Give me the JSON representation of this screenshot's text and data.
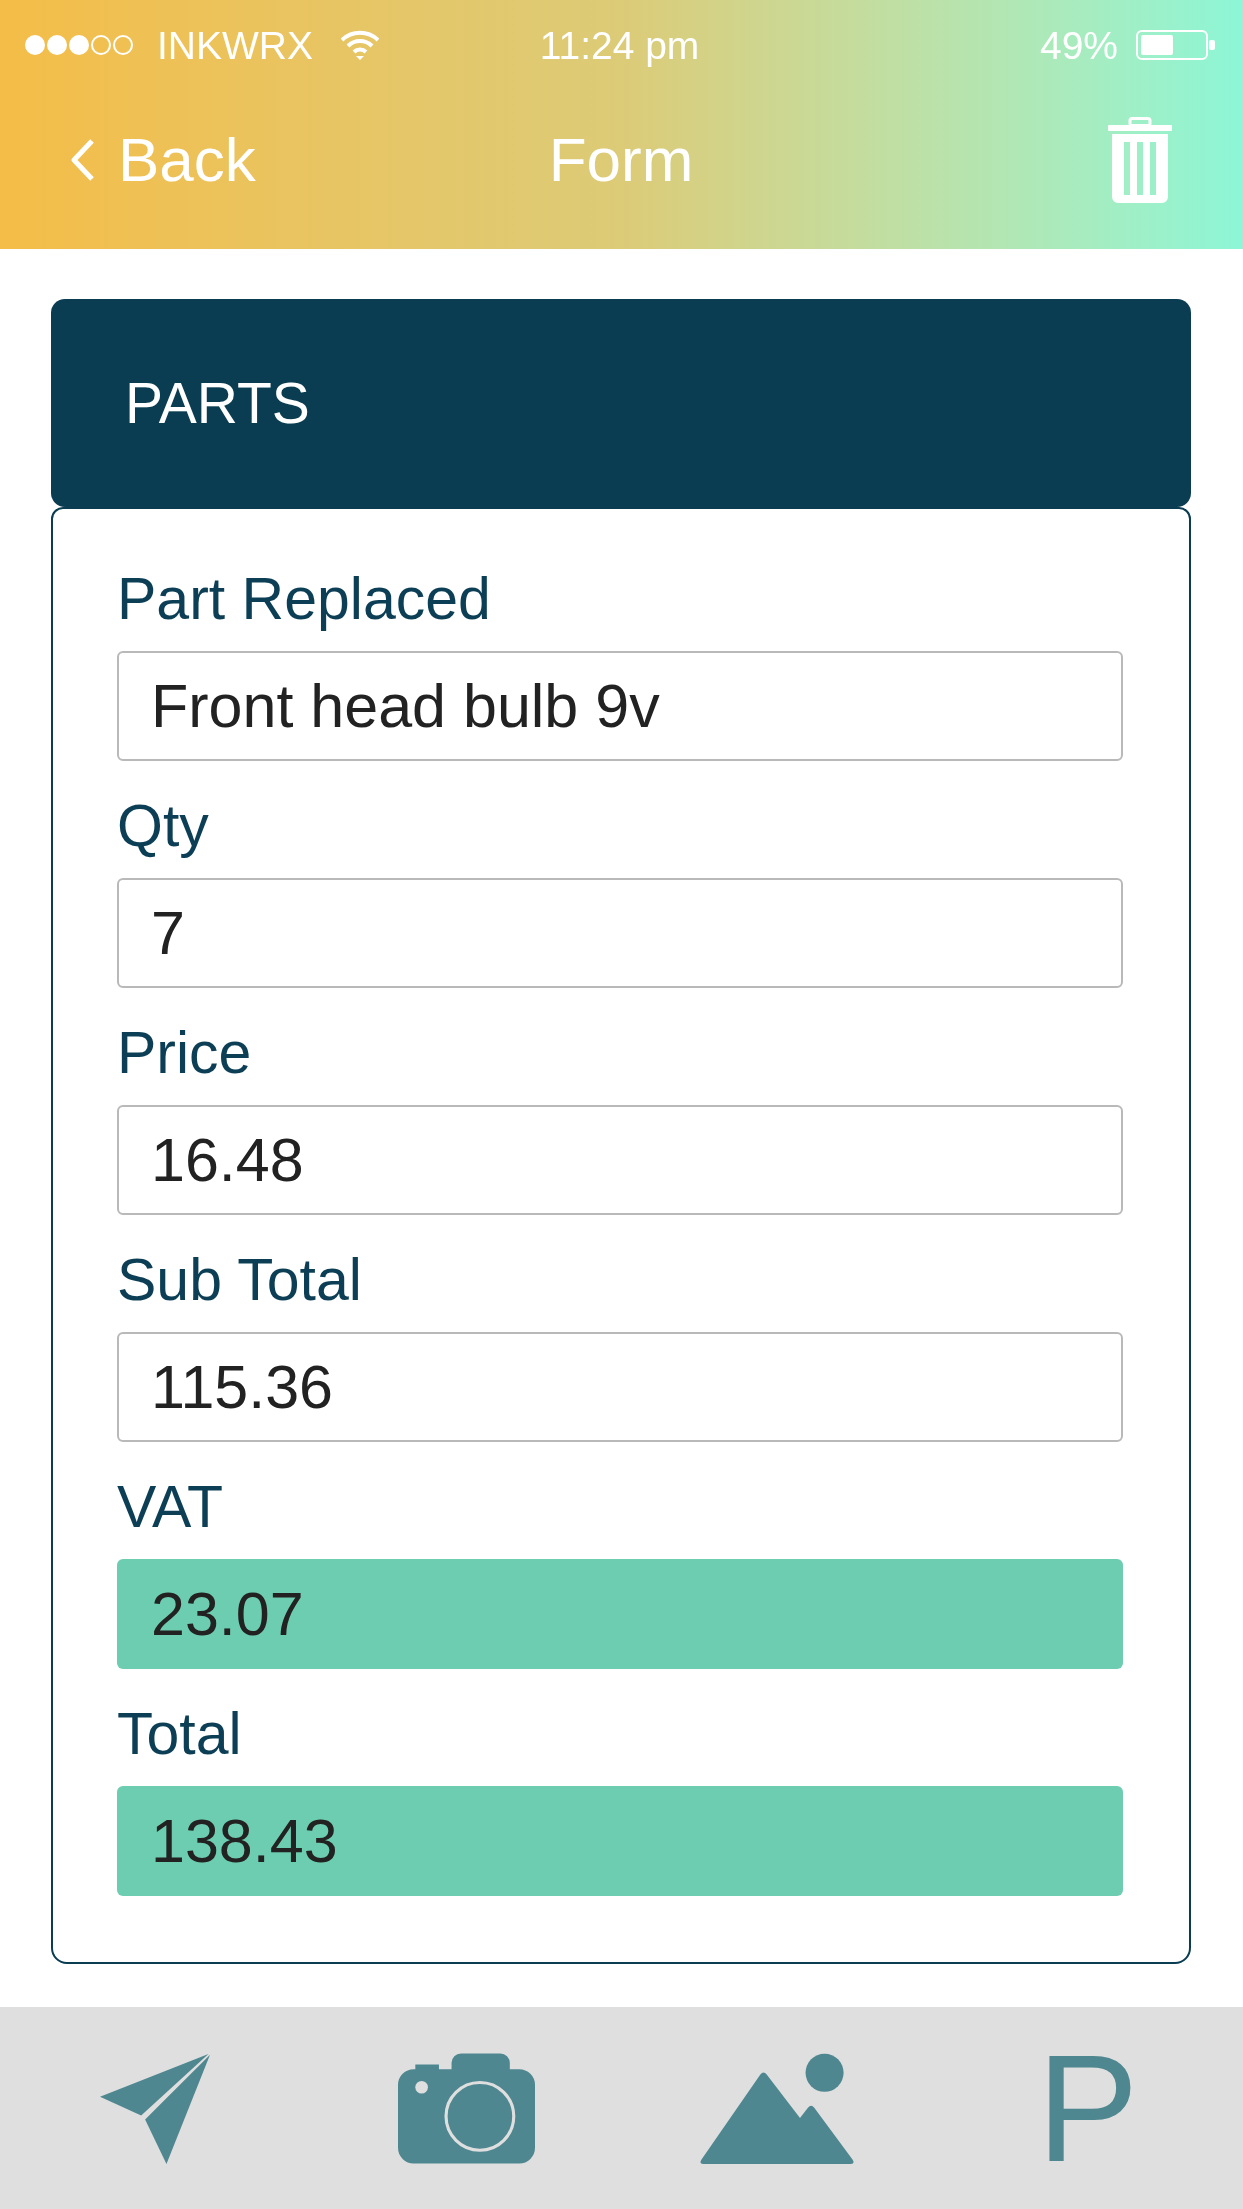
{
  "status_bar": {
    "carrier": "INKWRX",
    "time": "11:24 pm",
    "battery": "49%"
  },
  "nav_bar": {
    "back": "Back",
    "title": "Form"
  },
  "section": {
    "title": "PARTS",
    "fields": [
      {
        "label": "Part Replaced",
        "value": "Front head bulb 9v",
        "kind": "input"
      },
      {
        "label": "Qty",
        "value": "7",
        "kind": "input"
      },
      {
        "label": "Price",
        "value": "16.48",
        "kind": "input"
      },
      {
        "label": "Sub Total",
        "value": "115.36",
        "kind": "input"
      },
      {
        "label": "VAT",
        "value": "23.07",
        "kind": "calculated"
      },
      {
        "label": "Total",
        "value": "138.43",
        "kind": "calculated"
      }
    ]
  },
  "toolbar": {
    "letter_button": "P"
  }
}
